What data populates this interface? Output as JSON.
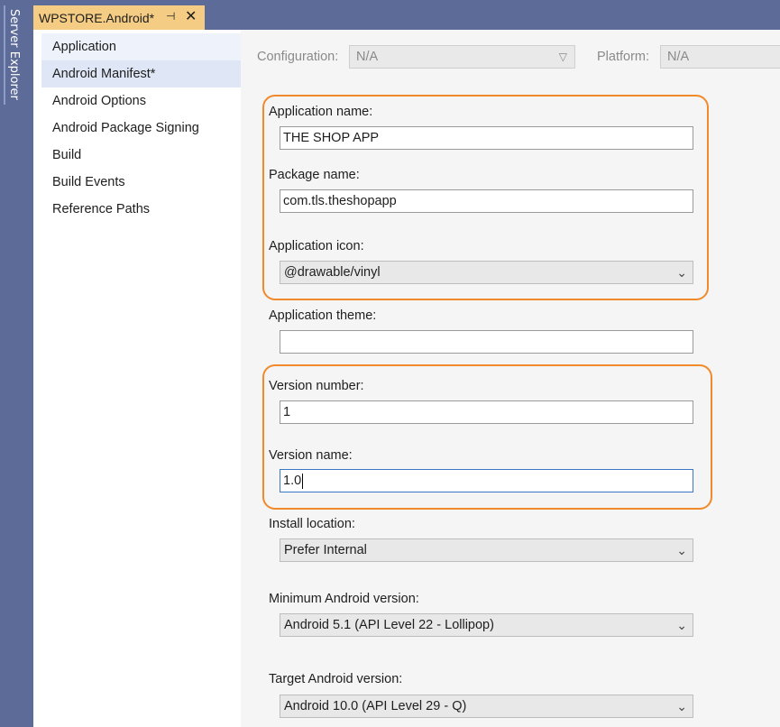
{
  "server_explorer": {
    "label": "Server Explorer"
  },
  "doc_tab": {
    "title": "WPSTORE.Android*",
    "pin_glyph": "⊣",
    "close_glyph": "✕"
  },
  "nav": {
    "items": [
      {
        "label": "Application"
      },
      {
        "label": "Android Manifest*"
      },
      {
        "label": "Android Options"
      },
      {
        "label": "Android Package Signing"
      },
      {
        "label": "Build"
      },
      {
        "label": "Build Events"
      },
      {
        "label": "Reference Paths"
      }
    ]
  },
  "config": {
    "configuration_label": "Configuration:",
    "configuration_value": "N/A",
    "platform_label": "Platform:",
    "platform_value": "N/A"
  },
  "form": {
    "app_name_label": "Application name:",
    "app_name_value": "THE SHOP APP",
    "package_name_label": "Package name:",
    "package_name_value": "com.tls.theshopapp",
    "app_icon_label": "Application icon:",
    "app_icon_value": "@drawable/vinyl",
    "app_theme_label": "Application theme:",
    "app_theme_value": "",
    "version_number_label": "Version number:",
    "version_number_value": "1",
    "version_name_label": "Version name:",
    "version_name_value": "1.0",
    "install_location_label": "Install location:",
    "install_location_value": "Prefer Internal",
    "min_android_label": "Minimum Android version:",
    "min_android_value": "Android 5.1 (API Level 22 - Lollipop)",
    "target_android_label": "Target Android version:",
    "target_android_value": "Android 10.0 (API Level 29 - Q)"
  },
  "colors": {
    "chrome": "#5d6b99",
    "tab_active": "#f5cc84",
    "highlight": "#f08a2b",
    "focus": "#3b77c4"
  },
  "icons": [
    "pin-icon",
    "close-icon",
    "chevron-down-icon"
  ]
}
